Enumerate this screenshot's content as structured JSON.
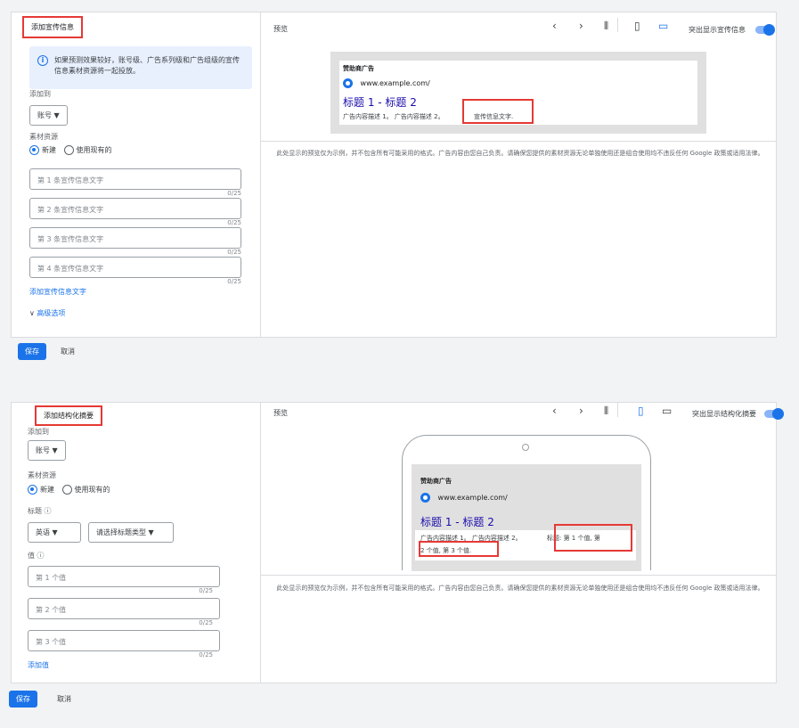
{
  "p1": {
    "title": "添加宣传信息",
    "info_text": "如果预测效果较好，账号级、广告系列级和广告组级的宣传信息素材资源将一起投放。",
    "add_to_label": "添加到",
    "account_dropdown": "账号 ▼",
    "source_label": "素材资源",
    "radio_new": "新建",
    "radio_existing": "使用现有的",
    "inputs": [
      {
        "placeholder": "第 1 条宣传信息文字",
        "counter": "0/25"
      },
      {
        "placeholder": "第 2 条宣传信息文字",
        "counter": "0/25"
      },
      {
        "placeholder": "第 3 条宣传信息文字",
        "counter": "0/25"
      },
      {
        "placeholder": "第 4 条宣传信息文字",
        "counter": "0/25"
      }
    ],
    "add_link": "添加宣传信息文字",
    "advanced": "高级选项",
    "preview_label": "预览",
    "toggle_label": "突出显示宣传信息",
    "ad": {
      "sponsor": "赞助商广告",
      "url": "www.example.com/",
      "headline": "标题 1 - 标题 2",
      "desc": "广告内容描述 1。 广告内容描述 2。",
      "callout": "宣传信息文字."
    },
    "disclaimer": "此处显示的预览仅为示例，并不包含所有可能采用的格式。广告内容由您自己负责。请确保您提供的素材资源无论单独使用还是组合使用均不违反任何 Google 政策或适用法律。",
    "save": "保存",
    "cancel": "取消"
  },
  "p2": {
    "title": "添加结构化摘要",
    "add_to_label": "添加到",
    "account_dropdown": "账号 ▼",
    "source_label": "素材资源",
    "radio_new": "新建",
    "radio_existing": "使用现有的",
    "header_label": "标题 ⓘ",
    "lang_dropdown": "英语   ▼",
    "type_dropdown": "请选择标题类型 ▼",
    "values_label": "值 ⓘ",
    "inputs": [
      {
        "placeholder": "第 1 个值",
        "counter": "0/25"
      },
      {
        "placeholder": "第 2 个值",
        "counter": "0/25"
      },
      {
        "placeholder": "第 3 个值",
        "counter": "0/25"
      }
    ],
    "add_link": "添加值",
    "preview_label": "预览",
    "toggle_label": "突出显示结构化摘要",
    "ad": {
      "sponsor": "赞助商广告",
      "url": "www.example.com/",
      "headline": "标题 1 - 标题 2",
      "desc": "广告内容描述 1。 广告内容描述 2。",
      "snippet_a": "标题: 第 1 个值, 第",
      "snippet_b": "2 个值, 第 3 个值."
    },
    "disclaimer": "此处显示的预览仅为示例，并不包含所有可能采用的格式。广告内容由您自己负责。请确保您提供的素材资源无论单独使用还是组合使用均不违反任何 Google 政策或适用法律。",
    "save": "保存",
    "cancel": "取消"
  },
  "icons": {
    "prev": "‹",
    "next": "›",
    "columns": "⫴",
    "mobile": "▯",
    "desktop": "▭"
  }
}
